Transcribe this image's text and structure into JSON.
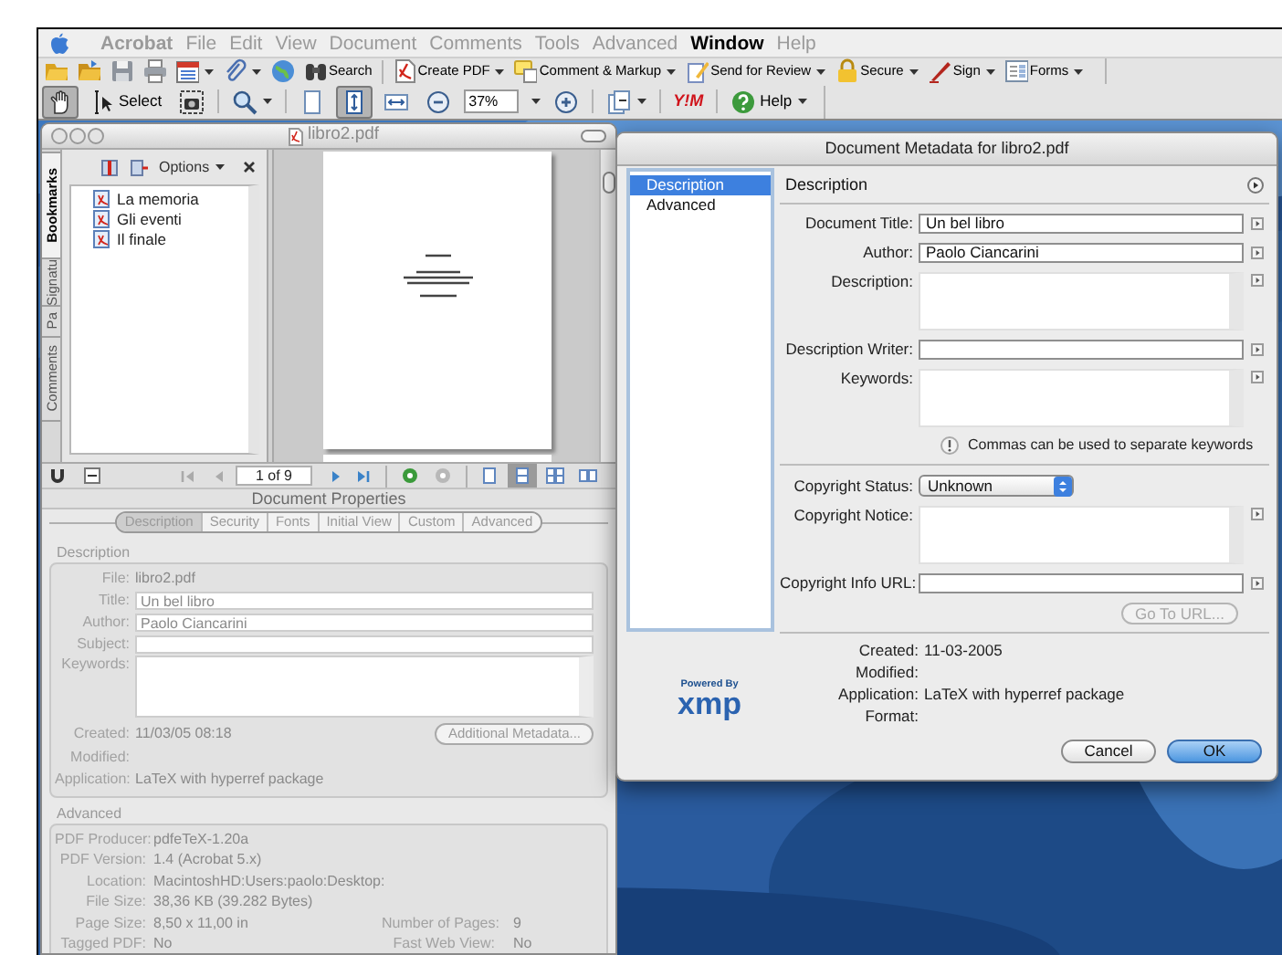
{
  "menu_bar": [
    {
      "label": "Acrobat",
      "active": false
    },
    {
      "label": "File",
      "active": false
    },
    {
      "label": "Edit",
      "active": false
    },
    {
      "label": "View",
      "active": false
    },
    {
      "label": "Document",
      "active": false
    },
    {
      "label": "Comments",
      "active": false
    },
    {
      "label": "Tools",
      "active": false
    },
    {
      "label": "Advanced",
      "active": false
    },
    {
      "label": "Window",
      "active": true
    },
    {
      "label": "Help",
      "active": false
    }
  ],
  "toolbar": [
    {
      "dropdown": false
    },
    {
      "dropdown": false
    },
    {
      "dropdown": false
    },
    {
      "dropdown": false
    },
    {
      "dropdown": true
    },
    {
      "dropdown": true
    },
    {
      "dropdown": false
    },
    {
      "label": "Search",
      "dropdown": false
    },
    {
      "label": "Create PDF",
      "dropdown": true
    },
    {
      "label": "Comment & Markup",
      "dropdown": true
    },
    {
      "label": "Send for Review",
      "dropdown": true
    },
    {
      "label": "Secure",
      "dropdown": true
    },
    {
      "label": "Sign",
      "dropdown": true
    },
    {
      "label": "Forms",
      "dropdown": true
    }
  ],
  "toolbar_2": [
    {
      "kind": "tool",
      "selected": true,
      "dropdown": false
    },
    {
      "kind": "tool",
      "label": "Select",
      "selected": false,
      "dropdown": false
    },
    {
      "kind": "tool",
      "selected": false,
      "dropdown": false
    },
    {
      "kind": "tool",
      "selected": false,
      "dropdown": true
    },
    {
      "kind": "tool",
      "selected": false,
      "dropdown": false
    },
    {
      "kind": "tool",
      "selected": true,
      "dropdown": false
    },
    {
      "kind": "tool",
      "selected": false,
      "dropdown": false
    },
    {
      "kind": "tool",
      "selected": false,
      "dropdown": false
    },
    {
      "kind": "field",
      "value": "37%"
    },
    {
      "kind": "menu"
    },
    {
      "kind": "tool",
      "selected": false,
      "dropdown": false
    },
    {
      "kind": "tool",
      "selected": false,
      "dropdown": true
    },
    {
      "kind": "logo",
      "label": "Y!M",
      "selected": false,
      "dropdown": false
    },
    {
      "kind": "tool",
      "label": "Help",
      "selected": false,
      "dropdown": true
    }
  ],
  "document_window": {
    "title": "libro2.pdf",
    "side_tabs": [
      {
        "label": "Bookmarks",
        "selected": true
      },
      {
        "label": "Signatu",
        "selected": false
      },
      {
        "label": "Pa",
        "selected": false
      },
      {
        "label": "Comments",
        "selected": false
      }
    ],
    "bookmarks_options": "Options",
    "bookmarks": [
      {
        "label": "La memoria",
        "selected": false
      },
      {
        "label": "Gli eventi",
        "selected": false
      },
      {
        "label": "Il finale",
        "selected": false
      }
    ],
    "page_field": "1 of 9",
    "view_modes": [
      {
        "selected": false
      },
      {
        "selected": true
      },
      {
        "selected": false
      },
      {
        "selected": false
      }
    ]
  },
  "document_properties": {
    "title": "Document Properties",
    "tabs": [
      {
        "label": "Description",
        "selected": true
      },
      {
        "label": "Security",
        "selected": false
      },
      {
        "label": "Fonts",
        "selected": false
      },
      {
        "label": "Initial View",
        "selected": false
      },
      {
        "label": "Custom",
        "selected": false
      },
      {
        "label": "Advanced",
        "selected": false
      }
    ],
    "description": {
      "heading": "Description",
      "rows": [
        {
          "kind": "static",
          "label": "File:",
          "value": "libro2.pdf"
        },
        {
          "kind": "text",
          "label": "Title:",
          "value": "Un bel libro"
        },
        {
          "kind": "text",
          "label": "Author:",
          "value": "Paolo Ciancarini"
        },
        {
          "kind": "text",
          "label": "Subject:"
        },
        {
          "kind": "area",
          "label": "Keywords:"
        },
        {
          "kind": "static",
          "label": "Created:",
          "value": "11/03/05 08:18",
          "button": "Additional Metadata..."
        },
        {
          "kind": "static",
          "label": "Modified:"
        },
        {
          "kind": "static",
          "label": "Application:",
          "value": "LaTeX with hyperref package"
        }
      ]
    },
    "advanced": {
      "heading": "Advanced",
      "rows": [
        {
          "label": "PDF Producer:",
          "value": "pdfeTeX-1.20a"
        },
        {
          "label": "PDF Version:",
          "value": "1.4 (Acrobat 5.x)"
        },
        {
          "label": "Location:",
          "value": "MacintoshHD:Users:paolo:Desktop:"
        },
        {
          "label": "File Size:",
          "value": "38,36 KB (39.282 Bytes)"
        },
        {
          "label": "Page Size:",
          "value": "8,50 x 11,00 in",
          "extra_label": "Number of Pages:",
          "extra_value": "9"
        },
        {
          "label": "Tagged PDF:",
          "value": "No",
          "extra_label": "Fast Web View:",
          "extra_value": "No"
        }
      ]
    }
  },
  "metadata_dialog": {
    "title": "Document Metadata for libro2.pdf",
    "sidebar": [
      {
        "label": "Description",
        "selected": true
      },
      {
        "label": "Advanced",
        "selected": false
      }
    ],
    "heading": "Description",
    "fields": [
      {
        "kind": "text",
        "label": "Document Title:",
        "value": "Un bel libro"
      },
      {
        "kind": "text",
        "label": "Author:",
        "value": "Paolo Ciancarini"
      },
      {
        "kind": "area",
        "label": "Description:"
      },
      {
        "kind": "text",
        "label": "Description Writer:"
      },
      {
        "kind": "area",
        "label": "Keywords:"
      }
    ],
    "note": "Commas can be used to separate keywords",
    "copyright_fields": [
      {
        "kind": "select",
        "label": "Copyright Status:",
        "value": "Unknown"
      },
      {
        "kind": "area",
        "label": "Copyright Notice:"
      },
      {
        "kind": "text",
        "label": "Copyright Info URL:"
      }
    ],
    "go_to_url": {
      "label": "Go To URL...",
      "disabled": true
    },
    "info": [
      {
        "label": "Created:",
        "value": "11-03-2005"
      },
      {
        "label": "Modified:"
      },
      {
        "label": "Application:",
        "value": "LaTeX with hyperref package"
      },
      {
        "label": "Format:"
      }
    ],
    "logo": {
      "caption": "Powered By",
      "wordmark": "xmp"
    },
    "buttons": [
      {
        "label": "Cancel",
        "default": false
      },
      {
        "label": "OK",
        "default": true
      }
    ]
  }
}
